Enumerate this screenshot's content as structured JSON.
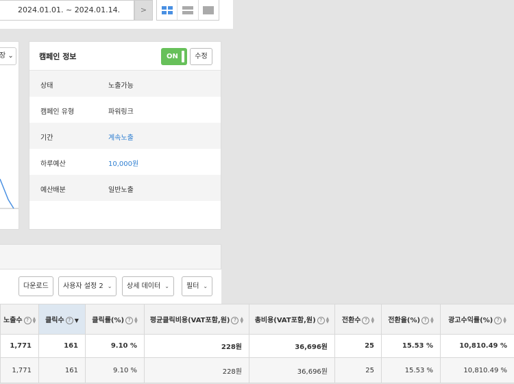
{
  "date_bar": {
    "range": "2024.01.01. ~ 2024.01.14.",
    "next_label": ">"
  },
  "chart_card": {
    "select_label": "장",
    "select_chevron": "⌄"
  },
  "campaign_info": {
    "title": "캠페인 정보",
    "toggle_label": "ON",
    "edit_label": "수정",
    "rows": [
      {
        "label": "상태",
        "value": "노출가능"
      },
      {
        "label": "캠페인 유형",
        "value": "파워링크"
      },
      {
        "label": "기간",
        "value": "계속노출"
      },
      {
        "label": "하루예산",
        "value": "10,000원"
      },
      {
        "label": "예산배분",
        "value": "일반노출"
      }
    ]
  },
  "toolbar": {
    "download": "다운로드",
    "user_setting": "사용자 설정 2",
    "detail_data": "상세 데이터",
    "filter": "필터",
    "chevron": "⌄"
  },
  "table": {
    "help_glyph": "?",
    "columns": [
      "노출수",
      "클릭수",
      "클릭률(%)",
      "평균클릭비용(VAT포함,원)",
      "총비용(VAT포함,원)",
      "전환수",
      "전환율(%)",
      "광고수익률(%)"
    ],
    "summary": [
      "1,771",
      "161",
      "9.10 %",
      "228원",
      "36,696원",
      "25",
      "15.53 %",
      "10,810.49 %"
    ],
    "rows": [
      [
        "1,771",
        "161",
        "9.10 %",
        "228원",
        "36,696원",
        "25",
        "15.53 %",
        "10,810.49 %"
      ]
    ]
  },
  "colors": {
    "toggle_on": "#67c05a",
    "link": "#2f7fd1",
    "chart_line": "#4a90e2",
    "sorted_header": "#dde7f1"
  }
}
